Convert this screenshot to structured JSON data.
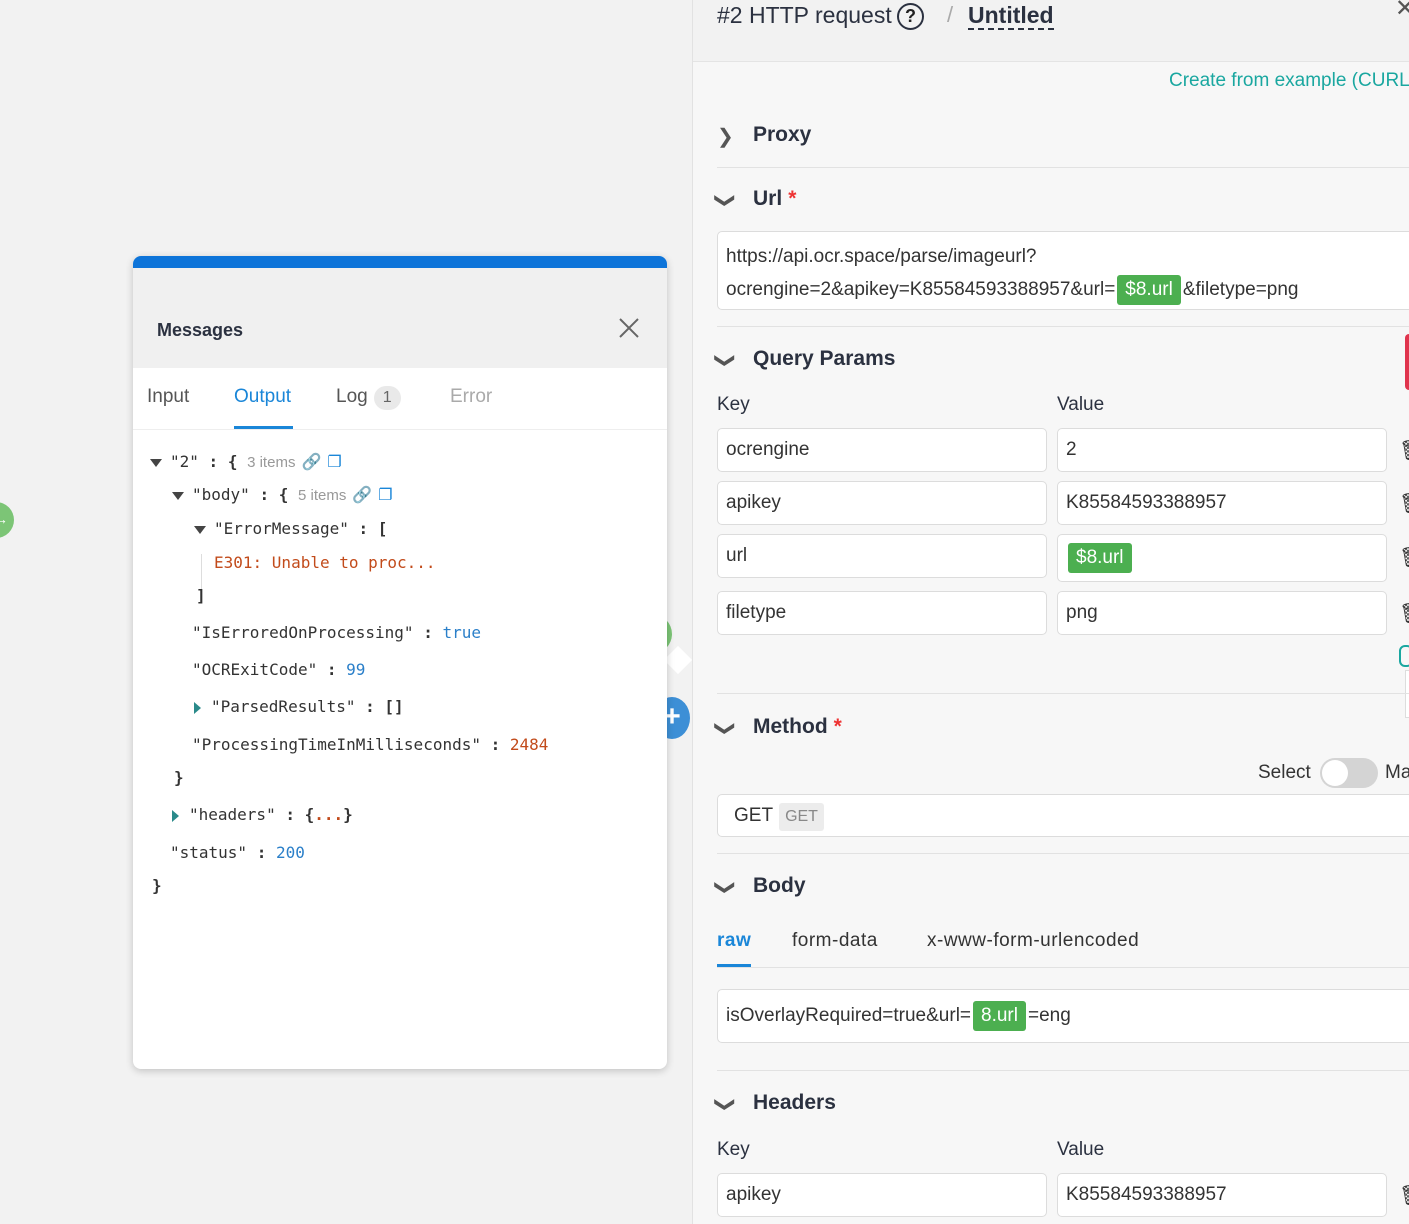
{
  "messages": {
    "title": "Messages",
    "tabs": {
      "input": "Input",
      "output": "Output",
      "log": "Log",
      "log_count": "1",
      "error": "Error"
    },
    "tree": {
      "root_key": "\"2\"",
      "root_meta": "3 items",
      "body_key": "\"body\"",
      "body_meta": "5 items",
      "error_message_key": "\"ErrorMessage\"",
      "error_message_value": "E301: Unable to proc...",
      "is_errored_key": "\"IsErroredOnProcessing\"",
      "is_errored_value": "true",
      "ocr_exit_key": "\"OCRExitCode\"",
      "ocr_exit_value": "99",
      "parsed_results_key": "\"ParsedResults\"",
      "parsed_results_value": "[]",
      "processing_time_key": "\"ProcessingTimeInMilliseconds\"",
      "processing_time_value": "2484",
      "headers_key": "\"headers\"",
      "headers_dots": "...",
      "status_key": "\"status\"",
      "status_value": "200"
    }
  },
  "panel": {
    "title": "#2 HTTP request",
    "help": "?",
    "separator": "/",
    "name": "Untitled",
    "create_from_example": "Create from example (CURL",
    "sections": {
      "proxy": "Proxy",
      "url": "Url",
      "query_params": "Query Params",
      "method": "Method",
      "body": "Body",
      "headers": "Headers"
    },
    "url": {
      "line1": "https://api.ocr.space/parse/imageurl?",
      "line2_prefix": "ocrengine=2&apikey=K85584593388957&url=",
      "pill": "$8.url",
      "line2_suffix": "&filetype=png"
    },
    "query_params": {
      "key_label": "Key",
      "value_label": "Value",
      "rows": [
        {
          "key": "ocrengine",
          "value": "2"
        },
        {
          "key": "apikey",
          "value": "K85584593388957"
        },
        {
          "key": "url",
          "value": "$8.url"
        },
        {
          "key": "filetype",
          "value": "png"
        }
      ]
    },
    "method": {
      "toggle_left": "Select",
      "toggle_right": "Ma",
      "selected": "GET",
      "tag": "GET"
    },
    "body": {
      "tabs": [
        "raw",
        "form-data",
        "x-www-form-urlencoded"
      ],
      "prefix": "isOverlayRequired=true&url=",
      "pill": "8.url",
      "suffix": "=eng"
    },
    "headers": {
      "key_label": "Key",
      "value_label": "Value",
      "rows": [
        {
          "key": "apikey",
          "value": "K85584593388957"
        }
      ]
    }
  },
  "colors": {
    "accent": "#1a86d8",
    "pill": "#4caf50",
    "teal": "#1aa7a0",
    "required": "#e33333"
  }
}
